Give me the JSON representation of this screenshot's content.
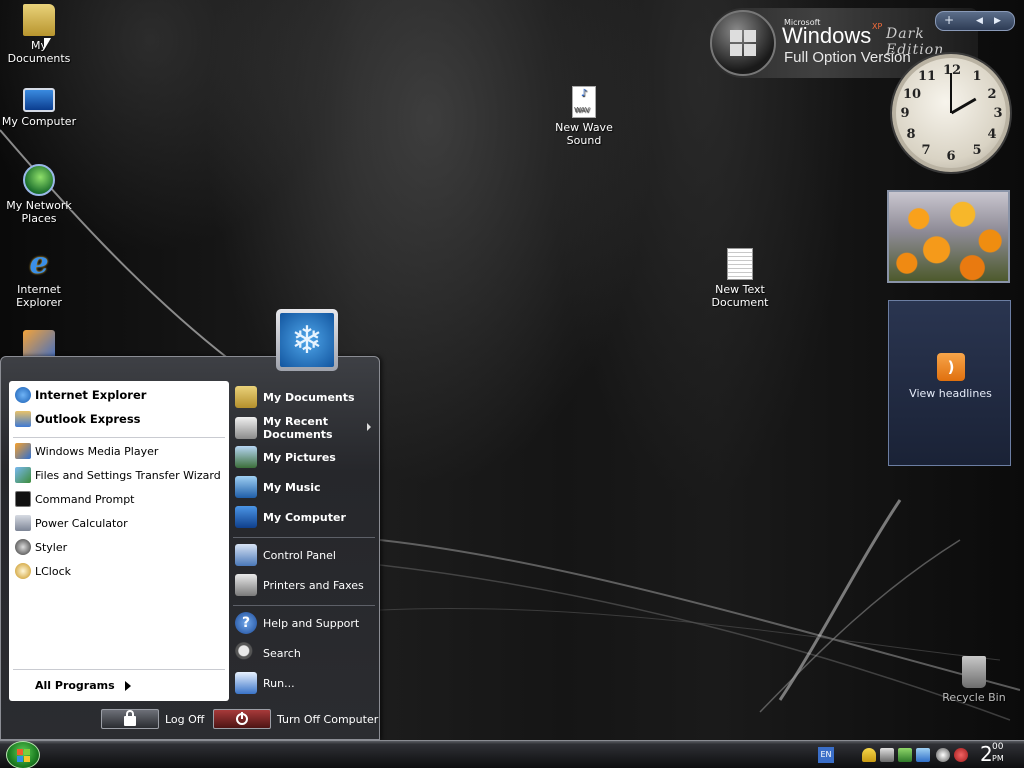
{
  "desktop": {
    "icons": [
      {
        "label": "My Documents",
        "icon": "folder-icon"
      },
      {
        "label": "My Computer",
        "icon": "computer-icon"
      },
      {
        "label": "My Network Places",
        "icon": "network-icon"
      },
      {
        "label": "Internet Explorer",
        "icon": "internet-explorer-icon"
      },
      {
        "label": "New Wave Sound",
        "icon": "wave-file-icon"
      },
      {
        "label": "New Text Document",
        "icon": "text-file-icon"
      },
      {
        "label": "Recycle Bin",
        "icon": "recycle-bin-icon"
      }
    ],
    "wav_badge": "WAV"
  },
  "logo": {
    "microsoft": "Microsoft",
    "windows": "Windows",
    "xp": "XP",
    "dark": "Dark Edition",
    "full_option": "Full Option Version"
  },
  "sidebar": {
    "add_button": "+",
    "prev_button": "◀",
    "next_button": "▶",
    "clock_numbers": [
      "12",
      "1",
      "2",
      "3",
      "4",
      "5",
      "6",
      "7",
      "8",
      "9",
      "10",
      "11"
    ],
    "feed_label": "View headlines"
  },
  "start_menu": {
    "pinned": [
      {
        "label": "Internet Explorer",
        "icon": "internet-explorer-icon"
      },
      {
        "label": "Outlook Express",
        "icon": "outlook-express-icon"
      }
    ],
    "recent": [
      {
        "label": "Windows Media Player",
        "icon": "media-player-icon"
      },
      {
        "label": "Files and Settings Transfer Wizard",
        "icon": "transfer-wizard-icon"
      },
      {
        "label": "Command Prompt",
        "icon": "command-prompt-icon"
      },
      {
        "label": "Power Calculator",
        "icon": "calculator-icon"
      },
      {
        "label": "Styler",
        "icon": "styler-icon"
      },
      {
        "label": "LClock",
        "icon": "lclock-icon"
      }
    ],
    "all_programs": "All Programs",
    "places": [
      {
        "label": "My Documents",
        "icon": "my-documents-icon"
      },
      {
        "label": "My Recent Documents",
        "icon": "recent-documents-icon"
      },
      {
        "label": "My Pictures",
        "icon": "my-pictures-icon"
      },
      {
        "label": "My Music",
        "icon": "my-music-icon"
      },
      {
        "label": "My Computer",
        "icon": "my-computer-icon"
      }
    ],
    "system": [
      {
        "label": "Control Panel",
        "icon": "control-panel-icon"
      },
      {
        "label": "Printers and Faxes",
        "icon": "printer-icon"
      }
    ],
    "help": [
      {
        "label": "Help and Support",
        "icon": "help-icon"
      },
      {
        "label": "Search",
        "icon": "search-icon"
      },
      {
        "label": "Run...",
        "icon": "run-icon"
      }
    ],
    "log_off": "Log Off",
    "turn_off": "Turn Off Computer"
  },
  "taskbar": {
    "language": "EN",
    "time_hour": "2",
    "time_minutes": "00",
    "time_ampm": "PM"
  },
  "colors": {
    "accent": "#2a64c8",
    "taskbar": "#1c1d20",
    "start_button": "#1d7f22"
  }
}
